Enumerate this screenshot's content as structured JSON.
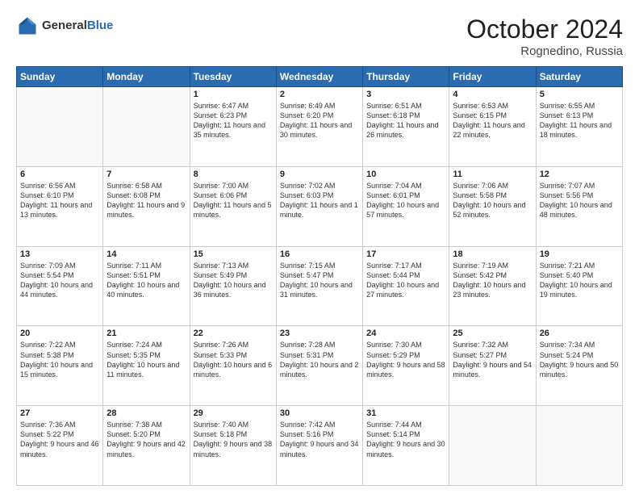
{
  "header": {
    "logo_general": "General",
    "logo_blue": "Blue",
    "month_title": "October 2024",
    "location": "Rognedino, Russia"
  },
  "days_of_week": [
    "Sunday",
    "Monday",
    "Tuesday",
    "Wednesday",
    "Thursday",
    "Friday",
    "Saturday"
  ],
  "weeks": [
    [
      {
        "day": "",
        "empty": true
      },
      {
        "day": "",
        "empty": true
      },
      {
        "day": "1",
        "sunrise": "Sunrise: 6:47 AM",
        "sunset": "Sunset: 6:23 PM",
        "daylight": "Daylight: 11 hours and 35 minutes."
      },
      {
        "day": "2",
        "sunrise": "Sunrise: 6:49 AM",
        "sunset": "Sunset: 6:20 PM",
        "daylight": "Daylight: 11 hours and 30 minutes."
      },
      {
        "day": "3",
        "sunrise": "Sunrise: 6:51 AM",
        "sunset": "Sunset: 6:18 PM",
        "daylight": "Daylight: 11 hours and 26 minutes."
      },
      {
        "day": "4",
        "sunrise": "Sunrise: 6:53 AM",
        "sunset": "Sunset: 6:15 PM",
        "daylight": "Daylight: 11 hours and 22 minutes."
      },
      {
        "day": "5",
        "sunrise": "Sunrise: 6:55 AM",
        "sunset": "Sunset: 6:13 PM",
        "daylight": "Daylight: 11 hours and 18 minutes."
      }
    ],
    [
      {
        "day": "6",
        "sunrise": "Sunrise: 6:56 AM",
        "sunset": "Sunset: 6:10 PM",
        "daylight": "Daylight: 11 hours and 13 minutes."
      },
      {
        "day": "7",
        "sunrise": "Sunrise: 6:58 AM",
        "sunset": "Sunset: 6:08 PM",
        "daylight": "Daylight: 11 hours and 9 minutes."
      },
      {
        "day": "8",
        "sunrise": "Sunrise: 7:00 AM",
        "sunset": "Sunset: 6:06 PM",
        "daylight": "Daylight: 11 hours and 5 minutes."
      },
      {
        "day": "9",
        "sunrise": "Sunrise: 7:02 AM",
        "sunset": "Sunset: 6:03 PM",
        "daylight": "Daylight: 11 hours and 1 minute."
      },
      {
        "day": "10",
        "sunrise": "Sunrise: 7:04 AM",
        "sunset": "Sunset: 6:01 PM",
        "daylight": "Daylight: 10 hours and 57 minutes."
      },
      {
        "day": "11",
        "sunrise": "Sunrise: 7:06 AM",
        "sunset": "Sunset: 5:58 PM",
        "daylight": "Daylight: 10 hours and 52 minutes."
      },
      {
        "day": "12",
        "sunrise": "Sunrise: 7:07 AM",
        "sunset": "Sunset: 5:56 PM",
        "daylight": "Daylight: 10 hours and 48 minutes."
      }
    ],
    [
      {
        "day": "13",
        "sunrise": "Sunrise: 7:09 AM",
        "sunset": "Sunset: 5:54 PM",
        "daylight": "Daylight: 10 hours and 44 minutes."
      },
      {
        "day": "14",
        "sunrise": "Sunrise: 7:11 AM",
        "sunset": "Sunset: 5:51 PM",
        "daylight": "Daylight: 10 hours and 40 minutes."
      },
      {
        "day": "15",
        "sunrise": "Sunrise: 7:13 AM",
        "sunset": "Sunset: 5:49 PM",
        "daylight": "Daylight: 10 hours and 36 minutes."
      },
      {
        "day": "16",
        "sunrise": "Sunrise: 7:15 AM",
        "sunset": "Sunset: 5:47 PM",
        "daylight": "Daylight: 10 hours and 31 minutes."
      },
      {
        "day": "17",
        "sunrise": "Sunrise: 7:17 AM",
        "sunset": "Sunset: 5:44 PM",
        "daylight": "Daylight: 10 hours and 27 minutes."
      },
      {
        "day": "18",
        "sunrise": "Sunrise: 7:19 AM",
        "sunset": "Sunset: 5:42 PM",
        "daylight": "Daylight: 10 hours and 23 minutes."
      },
      {
        "day": "19",
        "sunrise": "Sunrise: 7:21 AM",
        "sunset": "Sunset: 5:40 PM",
        "daylight": "Daylight: 10 hours and 19 minutes."
      }
    ],
    [
      {
        "day": "20",
        "sunrise": "Sunrise: 7:22 AM",
        "sunset": "Sunset: 5:38 PM",
        "daylight": "Daylight: 10 hours and 15 minutes."
      },
      {
        "day": "21",
        "sunrise": "Sunrise: 7:24 AM",
        "sunset": "Sunset: 5:35 PM",
        "daylight": "Daylight: 10 hours and 11 minutes."
      },
      {
        "day": "22",
        "sunrise": "Sunrise: 7:26 AM",
        "sunset": "Sunset: 5:33 PM",
        "daylight": "Daylight: 10 hours and 6 minutes."
      },
      {
        "day": "23",
        "sunrise": "Sunrise: 7:28 AM",
        "sunset": "Sunset: 5:31 PM",
        "daylight": "Daylight: 10 hours and 2 minutes."
      },
      {
        "day": "24",
        "sunrise": "Sunrise: 7:30 AM",
        "sunset": "Sunset: 5:29 PM",
        "daylight": "Daylight: 9 hours and 58 minutes."
      },
      {
        "day": "25",
        "sunrise": "Sunrise: 7:32 AM",
        "sunset": "Sunset: 5:27 PM",
        "daylight": "Daylight: 9 hours and 54 minutes."
      },
      {
        "day": "26",
        "sunrise": "Sunrise: 7:34 AM",
        "sunset": "Sunset: 5:24 PM",
        "daylight": "Daylight: 9 hours and 50 minutes."
      }
    ],
    [
      {
        "day": "27",
        "sunrise": "Sunrise: 7:36 AM",
        "sunset": "Sunset: 5:22 PM",
        "daylight": "Daylight: 9 hours and 46 minutes."
      },
      {
        "day": "28",
        "sunrise": "Sunrise: 7:38 AM",
        "sunset": "Sunset: 5:20 PM",
        "daylight": "Daylight: 9 hours and 42 minutes."
      },
      {
        "day": "29",
        "sunrise": "Sunrise: 7:40 AM",
        "sunset": "Sunset: 5:18 PM",
        "daylight": "Daylight: 9 hours and 38 minutes."
      },
      {
        "day": "30",
        "sunrise": "Sunrise: 7:42 AM",
        "sunset": "Sunset: 5:16 PM",
        "daylight": "Daylight: 9 hours and 34 minutes."
      },
      {
        "day": "31",
        "sunrise": "Sunrise: 7:44 AM",
        "sunset": "Sunset: 5:14 PM",
        "daylight": "Daylight: 9 hours and 30 minutes."
      },
      {
        "day": "",
        "empty": true
      },
      {
        "day": "",
        "empty": true
      }
    ]
  ]
}
